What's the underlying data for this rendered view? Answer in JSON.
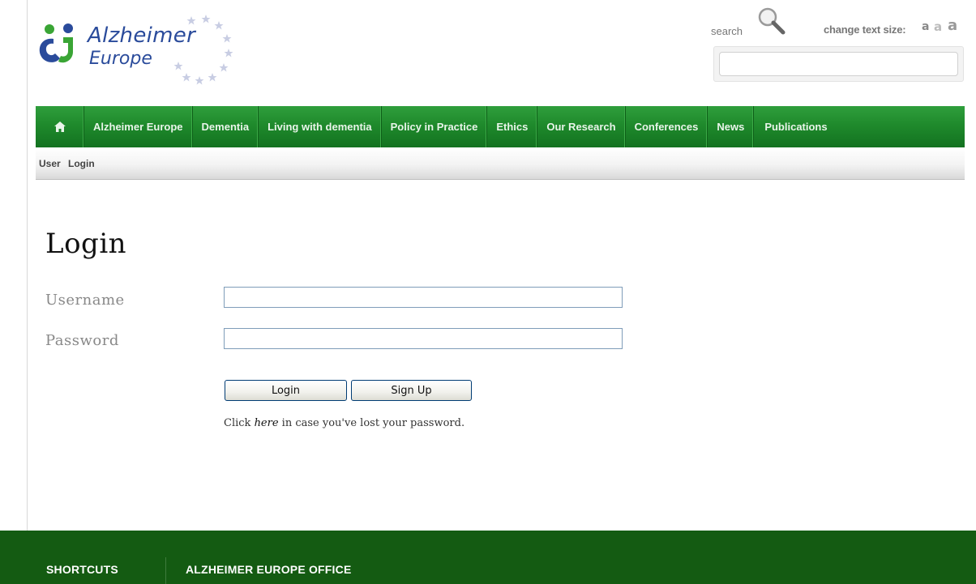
{
  "header": {
    "logo": {
      "line1": "Alzheimer",
      "line2": "Europe"
    },
    "search": {
      "label": "search",
      "value": "",
      "icon": "magnifier-icon"
    },
    "text_size": {
      "label": "change text size:",
      "options": [
        "a",
        "a",
        "a"
      ]
    }
  },
  "nav": {
    "home_icon": "home-icon",
    "items": [
      "Alzheimer Europe",
      "Dementia",
      "Living with dementia",
      "Policy in Practice",
      "Ethics",
      "Our Research",
      "Conferences",
      "News",
      "Publications"
    ]
  },
  "breadcrumb": {
    "items": [
      "User",
      "Login"
    ]
  },
  "login": {
    "title": "Login",
    "username_label": "Username",
    "username_value": "",
    "password_label": "Password",
    "password_value": "",
    "login_button": "Login",
    "signup_button": "Sign Up",
    "lost_prefix": "Click ",
    "lost_link": "here",
    "lost_suffix": " in case you've lost your password."
  },
  "footer": {
    "col1": "SHORTCUTS",
    "col2": "ALZHEIMER EUROPE OFFICE"
  },
  "colors": {
    "nav_green": "#1f8a2c",
    "footer_green": "#145b12",
    "logo_blue": "#2a4b9b",
    "logo_green": "#3aa535"
  }
}
